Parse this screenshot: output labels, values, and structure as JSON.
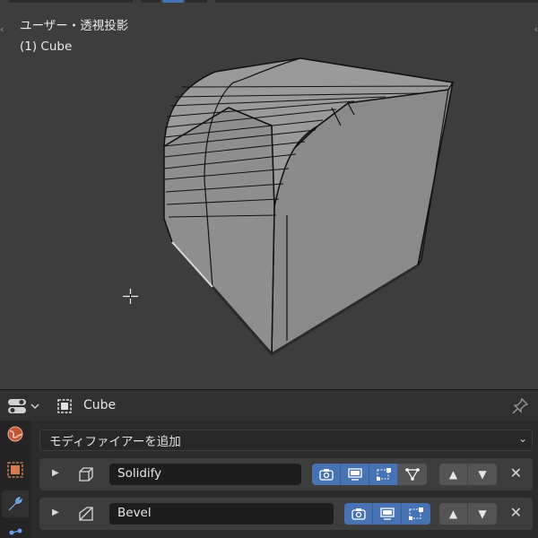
{
  "viewport": {
    "view_label": "ユーザー・透視投影",
    "object_label": "(1) Cube",
    "colors": {
      "background": "#3d3d3d",
      "mesh_face": "#909090",
      "mesh_edge": "#111111",
      "selected_edge": "#dcdcdc"
    }
  },
  "properties": {
    "editor_icon": "properties-editor-icon",
    "object_name": "Cube",
    "tabs": [
      {
        "name": "world-tab",
        "icon": "world-icon",
        "active": false
      },
      {
        "name": "object-tab",
        "icon": "object-icon",
        "active": false
      },
      {
        "name": "modifier-tab",
        "icon": "wrench-icon",
        "active": true
      },
      {
        "name": "particles-tab",
        "icon": "particles-icon",
        "active": false
      }
    ],
    "add_modifier_label": "モディファイアーを追加",
    "modifiers": [
      {
        "name": "Solidify",
        "icon": "solidify-icon"
      },
      {
        "name": "Bevel",
        "icon": "bevel-icon"
      }
    ]
  },
  "colors": {
    "accent": "#4772b3",
    "panel": "#3d3d3d",
    "field": "#1d1d1d"
  }
}
